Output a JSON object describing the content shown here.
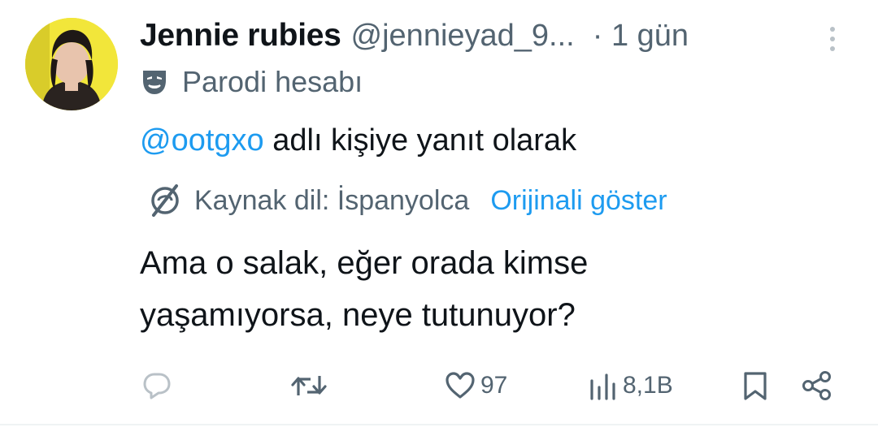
{
  "tweet": {
    "author_name": "Jennie rubies",
    "author_handle": "@jennieyad_9...",
    "time": "· 1 gün",
    "parody_label": "Parodi hesabı",
    "reply_mention": "@ootgxo",
    "reply_suffix": " adlı kişiye yanıt olarak",
    "source_language": "Kaynak dil: İspanyolca",
    "show_original": "Orijinali göster",
    "text_line1": "Ama o salak, eğer orada kimse",
    "text_line2": "yaşamıyorsa, neye tutunuyor?"
  },
  "actions": {
    "likes": "97",
    "views": "8,1B"
  },
  "icons": {
    "avatar": "avatar-photo",
    "more": "more-vertical-icon",
    "parody": "theater-mask-icon",
    "translate": "globe-icon",
    "reply": "reply-icon",
    "retweet": "retweet-icon",
    "like": "heart-icon",
    "views": "views-icon",
    "bookmark": "bookmark-icon",
    "share": "share-icon"
  },
  "colors": {
    "accent": "#1d9bf0",
    "text": "#0f1419",
    "secondary": "#536471"
  }
}
